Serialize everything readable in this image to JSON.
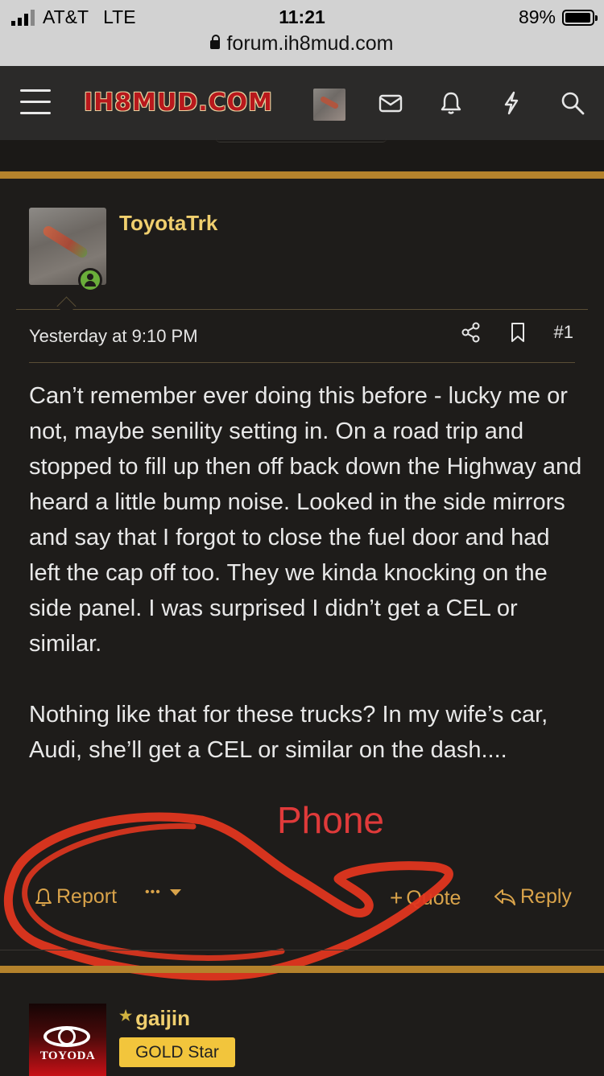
{
  "status_bar": {
    "carrier": "AT&T",
    "network": "LTE",
    "time": "11:21",
    "battery": "89%",
    "battery_level": 0.89,
    "url": "forum.ih8mud.com"
  },
  "nav": {
    "logo": "IH8MUD.COM",
    "icons": [
      "menu-icon",
      "user-avatar",
      "envelope-icon",
      "bell-icon",
      "lightning-icon",
      "search-icon"
    ]
  },
  "post": {
    "username": "ToyotaTrk",
    "date": "Yesterday at 9:10 PM",
    "post_number": "#1",
    "paragraphs": [
      "Can’t remember ever doing this before - lucky me or not, maybe senility setting in. On a road trip and stopped to fill up then off back down the Highway and heard a little bump noise. Looked in the side mirrors and say that I forgot to close the fuel door and had left the cap off too. They we kinda knocking on the side panel. I was surprised I didn’t get a CEL or similar.",
      "Nothing like that for these trucks? In my wife’s car, Audi, she’ll get a CEL or similar on the dash...."
    ],
    "annotation": "Phone",
    "annotation_color": "#e03a3a",
    "footer": {
      "report": "Report",
      "more": "•••",
      "quote": "Quote",
      "reply": "Reply"
    }
  },
  "next_post": {
    "username": "gaijin",
    "avatar_text": "TOYODA",
    "badge": "GOLD Star"
  },
  "colors": {
    "background": "#1e1c1a",
    "gold": "#b4822c",
    "username": "#f0cf6e",
    "link": "#d9a34a",
    "badge": "#f2c53c"
  }
}
